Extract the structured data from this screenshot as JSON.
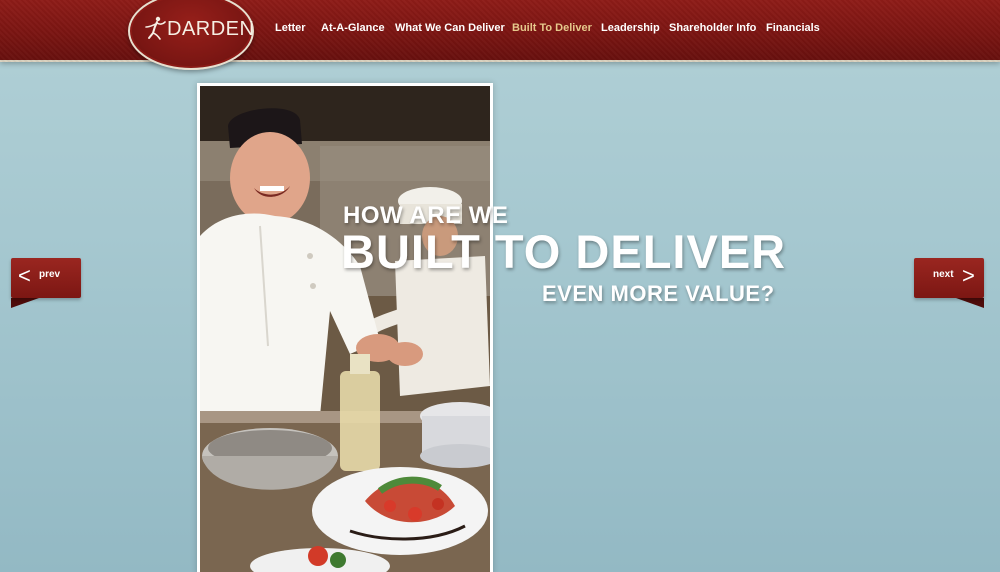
{
  "header": {
    "logo_text": "DARDEN",
    "logo_icon": "dancing-figure-icon",
    "nav": [
      {
        "label": "Letter",
        "active": false
      },
      {
        "label": "At-A-Glance",
        "active": false
      },
      {
        "label": "What We Can Deliver",
        "active": false
      },
      {
        "label": "Built To Deliver",
        "active": true
      },
      {
        "label": "Leadership",
        "active": false
      },
      {
        "label": "Shareholder Info",
        "active": false
      },
      {
        "label": "Financials",
        "active": false
      }
    ]
  },
  "hero": {
    "line1": "HOW ARE WE",
    "line2": "BUILT TO DELIVER",
    "line3": "EVEN MORE VALUE?",
    "photo_description": "chef-in-kitchen-photo"
  },
  "pager": {
    "prev_label": "prev",
    "next_label": "next",
    "prev_icon": "chevron-left-icon",
    "next_icon": "chevron-right-icon"
  },
  "colors": {
    "header_red": "#7b1512",
    "nav_active": "#e6c98c",
    "background_top": "#b1d0d6",
    "background_bottom": "#93b9c4"
  }
}
